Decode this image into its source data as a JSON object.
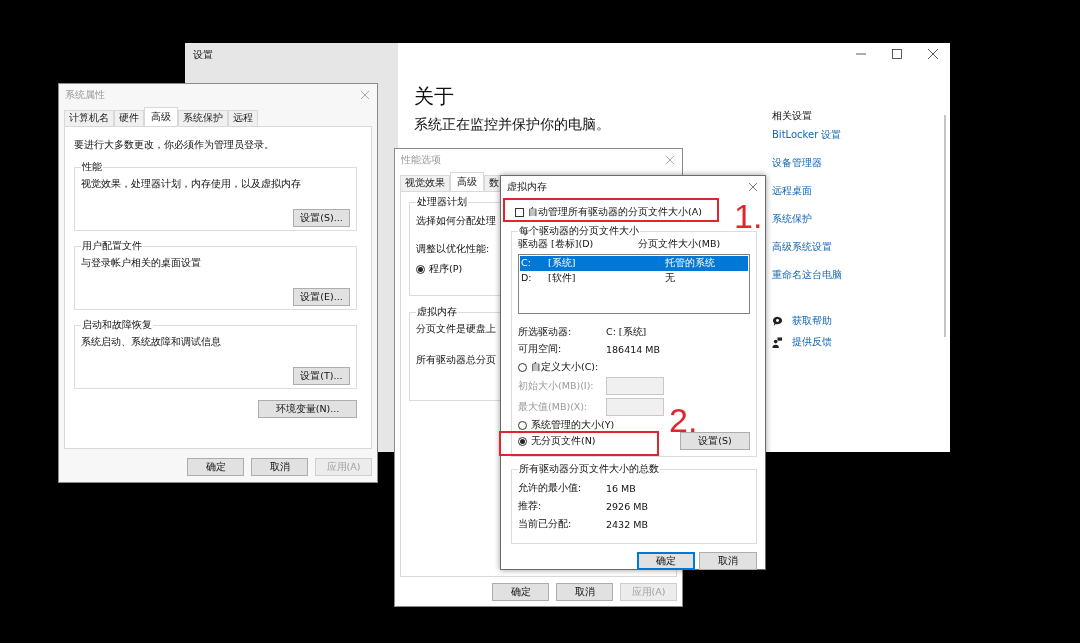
{
  "settings_window": {
    "title": "设置",
    "heading": "关于",
    "subtitle": "系统正在监控并保护你的电脑。",
    "related_title": "相关设置",
    "related_links": [
      "BitLocker 设置",
      "设备管理器",
      "远程桌面",
      "系统保护",
      "高级系统设置",
      "重命名这台电脑"
    ],
    "help_links": [
      {
        "label": "获取帮助",
        "kind": "help"
      },
      {
        "label": "提供反馈",
        "kind": "feedback"
      }
    ]
  },
  "system_properties": {
    "title": "系统属性",
    "tabs": [
      {
        "label": "计算机名",
        "selected": false
      },
      {
        "label": "硬件",
        "selected": false
      },
      {
        "label": "高级",
        "selected": true
      },
      {
        "label": "系统保护",
        "selected": false
      },
      {
        "label": "远程",
        "selected": false
      }
    ],
    "intro": "要进行大多数更改，你必须作为管理员登录。",
    "groups": [
      {
        "title": "性能",
        "description": "视觉效果，处理器计划，内存使用，以及虚拟内存",
        "button": "设置(S)..."
      },
      {
        "title": "用户配置文件",
        "description": "与登录帐户相关的桌面设置",
        "button": "设置(E)..."
      },
      {
        "title": "启动和故障恢复",
        "description": "系统启动、系统故障和调试信息",
        "button": "设置(T)..."
      }
    ],
    "env_button": "环境变量(N)...",
    "buttons": [
      {
        "label": "确定",
        "disabled": false
      },
      {
        "label": "取消",
        "disabled": false
      },
      {
        "label": "应用(A)",
        "disabled": true
      }
    ]
  },
  "performance_options": {
    "title": "性能选项",
    "tabs": [
      {
        "label": "视觉效果",
        "selected": false
      },
      {
        "label": "高级",
        "selected": true
      },
      {
        "label": "数",
        "selected": false
      }
    ],
    "processor_group": {
      "title": "处理器计划",
      "description": "选择如何分配处理",
      "adjust_label": "调整以优化性能:",
      "radio": {
        "label": "程序(P)",
        "selected": true
      }
    },
    "memory_group": {
      "title": "虚拟内存",
      "lines": [
        "分页文件是硬盘上",
        "所有驱动器总分页"
      ]
    },
    "buttons": [
      {
        "label": "确定",
        "disabled": false
      },
      {
        "label": "取消",
        "disabled": false
      },
      {
        "label": "应用(A)",
        "disabled": true
      }
    ]
  },
  "virtual_memory": {
    "title": "虚拟内存",
    "auto_manage": {
      "label": "自动管理所有驱动器的分页文件大小(A)",
      "checked": false
    },
    "drives_group_title": "每个驱动器的分页文件大小",
    "columns": [
      "驱动器 [卷标](D)",
      "分页文件大小(MB)"
    ],
    "drives": [
      {
        "drive": "C:",
        "label": "[系统]",
        "size": "托管的系统",
        "selected": true
      },
      {
        "drive": "D:",
        "label": "[软件]",
        "size": "无",
        "selected": false
      }
    ],
    "selected_drive_label": "所选驱动器:",
    "selected_drive": "C:  [系统]",
    "free_space_label": "可用空间:",
    "free_space": "186414 MB",
    "custom_size": {
      "label": "自定义大小(C):",
      "selected": false
    },
    "fields": [
      {
        "label": "初始大小(MB)(I):",
        "disabled": true
      },
      {
        "label": "最大值(MB)(X):",
        "disabled": true
      }
    ],
    "system_managed": {
      "label": "系统管理的大小(Y)",
      "selected": false
    },
    "no_paging": {
      "label": "无分页文件(N)",
      "selected": true
    },
    "set_button": "设置(S)",
    "totals": {
      "title": "所有驱动器分页文件大小的总数",
      "rows": [
        {
          "label": "允许的最小值:",
          "value": "16 MB"
        },
        {
          "label": "推荐:",
          "value": "2926 MB"
        },
        {
          "label": "当前已分配:",
          "value": "2432 MB"
        }
      ]
    },
    "buttons": [
      {
        "label": "确定",
        "default": true
      },
      {
        "label": "取消",
        "default": false
      }
    ]
  },
  "annotations": [
    {
      "label": "1."
    },
    {
      "label": "2."
    }
  ]
}
